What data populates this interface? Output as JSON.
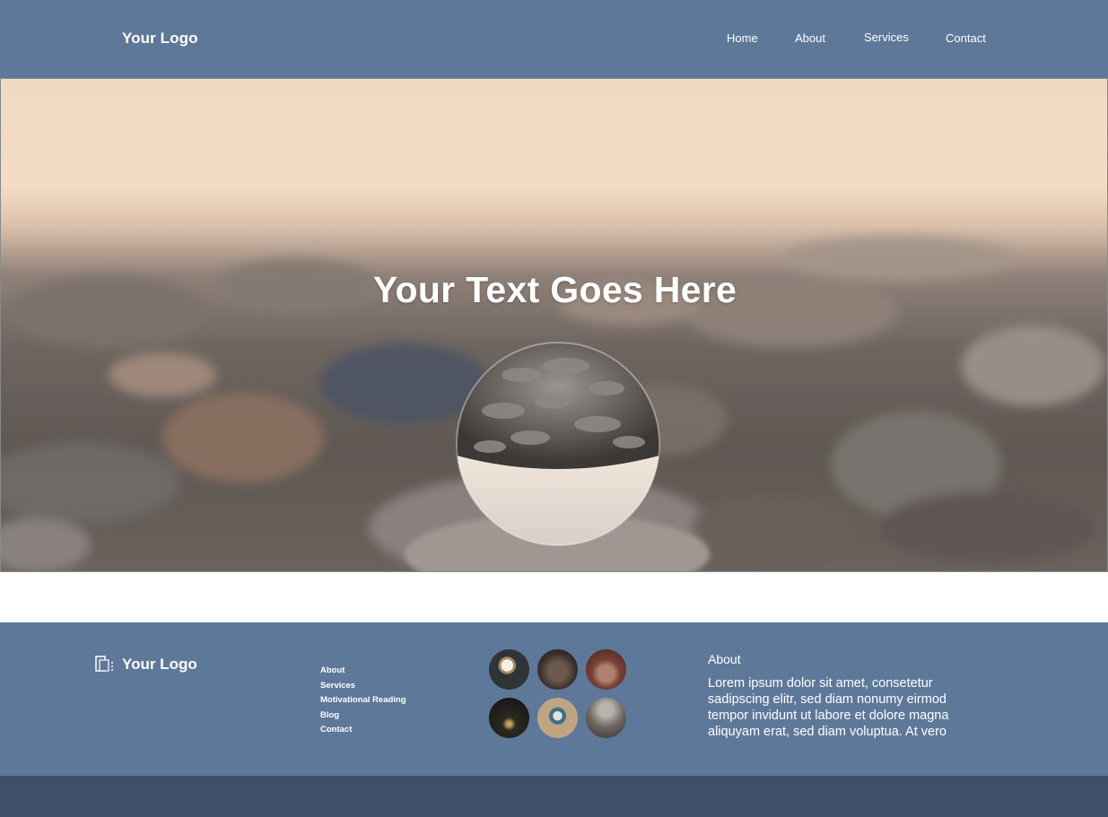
{
  "header": {
    "logo": "Your Logo",
    "nav": [
      {
        "label": "Home"
      },
      {
        "label": "About"
      },
      {
        "label": "Services"
      },
      {
        "label": "Contact"
      }
    ]
  },
  "hero": {
    "title": "Your Text Goes Here"
  },
  "footer": {
    "logo": "Your Logo",
    "links": [
      {
        "label": "About"
      },
      {
        "label": "Services"
      },
      {
        "label": "Motivational Reading"
      },
      {
        "label": "Blog"
      },
      {
        "label": "Contact"
      }
    ],
    "gallery": [
      "photo-1",
      "photo-2",
      "photo-3",
      "photo-4",
      "photo-5",
      "photo-6"
    ],
    "about_title": "About",
    "about_text": "Lorem ipsum dolor sit amet, consetetur sadipscing elitr, sed diam nonumy eirmod tempor invidunt ut labore et dolore magna aliquyam erat, sed diam voluptua. At vero"
  },
  "colors": {
    "header_bg": "#5e7899",
    "footer_bg": "#5e7899",
    "bottom_bar": "#3e5068",
    "text": "#ffffff"
  }
}
